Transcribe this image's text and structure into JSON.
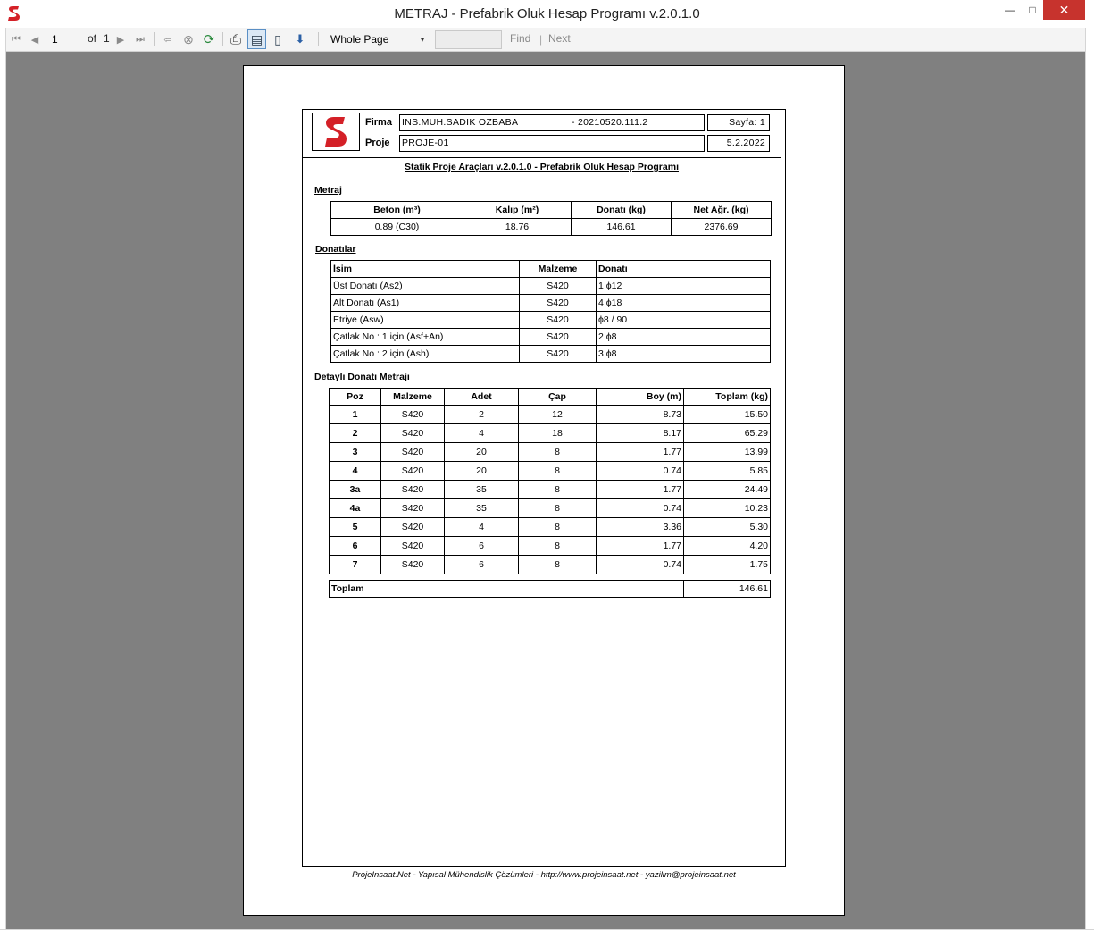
{
  "window": {
    "title": "METRAJ - Prefabrik Oluk Hesap Programı v.2.0.1.0",
    "minimize_glyph": "—",
    "maximize_glyph": "□",
    "close_glyph": "✕"
  },
  "toolbar": {
    "first_page_glyph": "⏮",
    "prev_page_glyph": "◀",
    "current_page": "1",
    "of_label": "of",
    "total_pages": "1",
    "next_page_glyph": "▶",
    "last_page_glyph": "⏭",
    "back_glyph": "⇦",
    "stop_glyph": "⊗",
    "refresh_glyph": "⟳",
    "print_glyph": "⎙",
    "layout_glyph": "▤",
    "page_setup_glyph": "▯",
    "export_glyph": "⬇",
    "zoom_value": "Whole Page",
    "zoom_caret": "▾",
    "search_value": "",
    "find_label": "Find",
    "separator": "|",
    "next_label": "Next"
  },
  "report": {
    "header": {
      "firma_label": "Firma",
      "firma_value": "INS.MUH.SADIK OZBABA",
      "firma_code": "- 20210520.111.2",
      "proje_label": "Proje",
      "proje_value": "PROJE-01",
      "sayfa": "Sayfa: 1",
      "date": "5.2.2022"
    },
    "title": "Statik Proje Araçları v.2.0.1.0 - Prefabrik Oluk Hesap Programı",
    "metraj": {
      "section_title": "Metraj",
      "headers": [
        "Beton (m³)",
        "Kalıp (m²)",
        "Donatı (kg)",
        "Net Ağr. (kg)"
      ],
      "values": [
        "0.89 (C30)",
        "18.76",
        "146.61",
        "2376.69"
      ]
    },
    "donatilar": {
      "section_title": "Donatılar",
      "headers": [
        "İsim",
        "Malzeme",
        "Donatı"
      ],
      "rows": [
        [
          "Üst Donatı (As2)",
          "S420",
          "1 ϕ12"
        ],
        [
          "Alt Donatı (As1)",
          "S420",
          "4 ϕ18"
        ],
        [
          "Etriye (Asw)",
          "S420",
          "ϕ8 / 90"
        ],
        [
          "Çatlak No : 1 için (Asf+An)",
          "S420",
          "2 ϕ8"
        ],
        [
          "Çatlak No : 2 için (Ash)",
          "S420",
          "3 ϕ8"
        ]
      ]
    },
    "detay": {
      "section_title": "Detaylı Donatı Metrajı",
      "headers": [
        "Poz",
        "Malzeme",
        "Adet",
        "Çap",
        "Boy (m)",
        "Toplam (kg)"
      ],
      "rows": [
        [
          "1",
          "S420",
          "2",
          "12",
          "8.73",
          "15.50"
        ],
        [
          "2",
          "S420",
          "4",
          "18",
          "8.17",
          "65.29"
        ],
        [
          "3",
          "S420",
          "20",
          "8",
          "1.77",
          "13.99"
        ],
        [
          "4",
          "S420",
          "20",
          "8",
          "0.74",
          "5.85"
        ],
        [
          "3a",
          "S420",
          "35",
          "8",
          "1.77",
          "24.49"
        ],
        [
          "4a",
          "S420",
          "35",
          "8",
          "0.74",
          "10.23"
        ],
        [
          "5",
          "S420",
          "4",
          "8",
          "3.36",
          "5.30"
        ],
        [
          "6",
          "S420",
          "6",
          "8",
          "1.77",
          "4.20"
        ],
        [
          "7",
          "S420",
          "6",
          "8",
          "0.74",
          "1.75"
        ]
      ],
      "total_label": "Toplam",
      "total_value": "146.61"
    },
    "footer": "ProjeInsaat.Net - Yapısal Mühendislik Çözümleri - http://www.projeinsaat.net - yazilim@projeinsaat.net"
  },
  "colors": {
    "logo_red": "#d42027",
    "viewer_background": "#808080",
    "close_button": "#c7332d"
  }
}
